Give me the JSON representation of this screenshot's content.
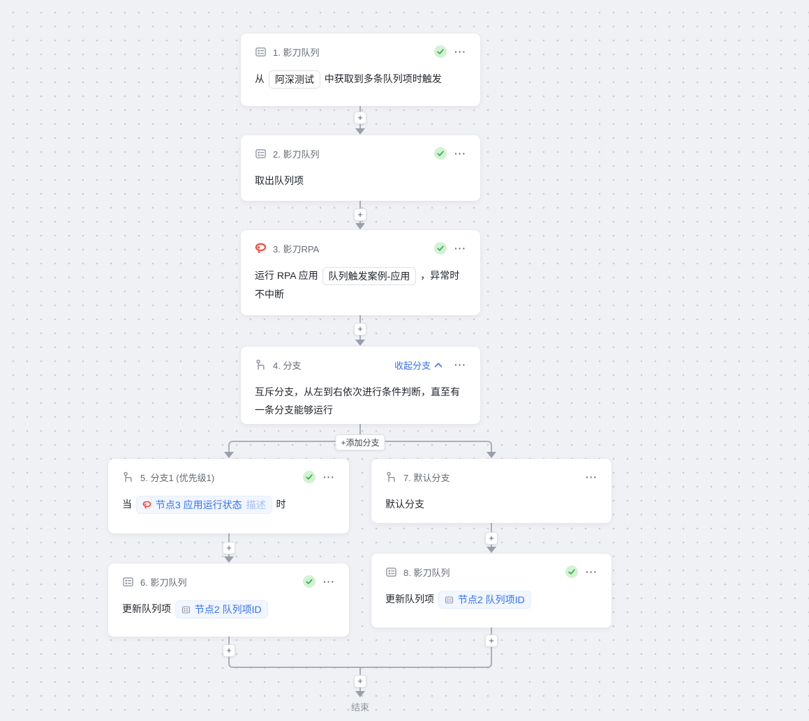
{
  "colors": {
    "accent_blue": "#3370ff",
    "success_green": "#2db54d",
    "rpa_red": "#f5483f",
    "line_gray": "#a9afba",
    "canvas_bg": "#f0f1f5"
  },
  "icons": {
    "more": "···",
    "plus": "+",
    "chevron_up": "∧"
  },
  "canvas": {
    "end_label": "结束",
    "add_branch_label": "+添加分支"
  },
  "nodes": [
    {
      "title": "1. 影刀队列",
      "icon": "queue-icon",
      "checked": true,
      "content": [
        {
          "text": "从 "
        },
        {
          "chip": {
            "variant": "plain",
            "parts": [
              {
                "text": "阿深测试"
              }
            ]
          }
        },
        {
          "text": " 中获取到多条队列项时触发"
        }
      ]
    },
    {
      "title": "2. 影刀队列",
      "icon": "queue-icon",
      "checked": true,
      "content": [
        {
          "text": "取出队列项"
        }
      ]
    },
    {
      "title": "3. 影刀RPA",
      "icon": "rpa-icon",
      "checked": true,
      "content": [
        {
          "text": "运行 RPA 应用 "
        },
        {
          "chip": {
            "variant": "plain",
            "parts": [
              {
                "text": "队列触发案例-应用"
              }
            ]
          }
        },
        {
          "text": " ，异常时不中断"
        }
      ]
    },
    {
      "title": "4. 分支",
      "icon": "branch-icon",
      "checked": false,
      "collapse_label": "收起分支",
      "content": [
        {
          "text": "互斥分支，从左到右依次进行条件判断，直至有一条分支能够运行"
        }
      ]
    },
    {
      "title": "5. 分支1 (优先级1)",
      "icon": "branch-icon",
      "checked": true,
      "content": [
        {
          "text": "当 "
        },
        {
          "chip": {
            "variant": "blue",
            "icon": "rpa-icon",
            "parts": [
              {
                "text": "节点3 应用运行状态"
              },
              {
                "text": "描述",
                "faded": true
              }
            ]
          }
        },
        {
          "text": " 时"
        }
      ]
    },
    {
      "title": "6. 影刀队列",
      "icon": "queue-icon",
      "checked": true,
      "content": [
        {
          "text": "更新队列项 "
        },
        {
          "chip": {
            "variant": "blue",
            "icon": "queue-icon",
            "parts": [
              {
                "text": "节点2 队列项ID"
              }
            ]
          }
        }
      ]
    },
    {
      "title": "7. 默认分支",
      "icon": "branch-icon",
      "checked": false,
      "content": [
        {
          "text": "默认分支"
        }
      ]
    },
    {
      "title": "8. 影刀队列",
      "icon": "queue-icon",
      "checked": true,
      "content": [
        {
          "text": "更新队列项 "
        },
        {
          "chip": {
            "variant": "blue",
            "icon": "queue-icon",
            "parts": [
              {
                "text": "节点2 队列项ID"
              }
            ]
          }
        }
      ]
    }
  ]
}
